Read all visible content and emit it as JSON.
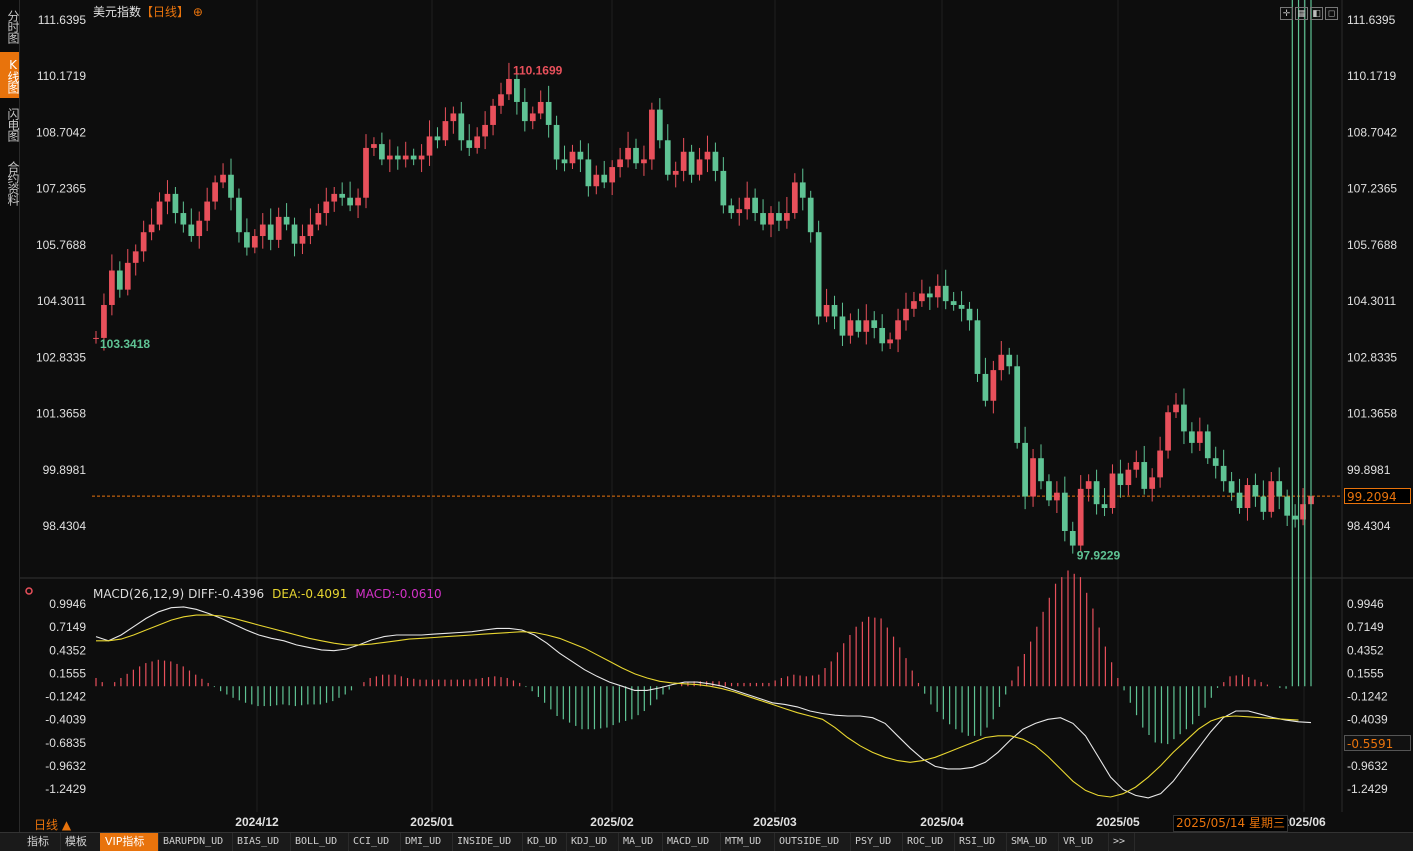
{
  "window": {
    "title": "美元指数",
    "period_tag": "【日线】",
    "add_icon": "circle-plus-icon"
  },
  "left_tabs": [
    {
      "label": "分时图",
      "active": false
    },
    {
      "label": "K线图",
      "active": true
    },
    {
      "label": "闪电图",
      "active": false
    },
    {
      "label": "合约资料",
      "active": false
    }
  ],
  "toolbar_icons": [
    "crosshair-icon",
    "grid-icon",
    "restore-icon",
    "maximize-icon"
  ],
  "colors": {
    "up": "#e8505b",
    "down": "#5fc394",
    "dif": "#e8e8e8",
    "dea": "#e8d630",
    "macd_label": "#d432c8",
    "accent": "#e8730c"
  },
  "price_axis": {
    "labels": [
      "111.6395",
      "110.1719",
      "108.7042",
      "107.2365",
      "105.7688",
      "104.3011",
      "102.8335",
      "101.3658",
      "99.8981",
      "98.4304"
    ],
    "min": 97.5,
    "max": 111.6395
  },
  "macd_axis": {
    "labels": [
      "0.9946",
      "0.7149",
      "0.4352",
      "0.1555",
      "-0.1242",
      "-0.4039",
      "-0.6835",
      "-0.9632",
      "-1.2429"
    ],
    "top": 0.9946,
    "bottom": -1.2429
  },
  "time_axis": [
    "2024/12",
    "2025/01",
    "2025/02",
    "2025/03",
    "2025/04",
    "2025/05",
    "2025/06"
  ],
  "annotations": {
    "start_low": "103.3418",
    "high": "110.1699",
    "low": "97.9229"
  },
  "last_price": "99.2094",
  "macd_cursor_value": "-0.5591",
  "macd_legend": {
    "params": "MACD(26,12,9)",
    "diff": "DIFF:-0.4396",
    "dea": "DEA:-0.4091",
    "macd": "MACD:-0.0610"
  },
  "period_label": "日线 ▲",
  "date_tip": "2025/05/14 星期三",
  "bottom_tabs": [
    "指标",
    "模板",
    "VIP指标",
    "BARUPDN_UD",
    "BIAS_UD",
    "BOLL_UD",
    "CCI_UD",
    "DMI_UD",
    "INSIDE_UD",
    "KD_UD",
    "KDJ_UD",
    "MA_UD",
    "MACD_UD",
    "MTM_UD",
    "OUTSIDE_UD",
    "PSY_UD",
    "ROC_UD",
    "RSI_UD",
    "SMA_UD",
    "VR_UD",
    ">>"
  ],
  "bottom_active_tab": "VIP指标",
  "chart_data": {
    "type": "candlestick",
    "title": "美元指数",
    "period": "日线",
    "x": [
      "2024/12",
      "2025/01",
      "2025/02",
      "2025/03",
      "2025/04",
      "2025/05",
      "2025/06"
    ],
    "ylim": [
      97.5,
      111.6395
    ],
    "closes": [
      103.34,
      104.2,
      105.1,
      104.6,
      105.3,
      105.6,
      106.1,
      106.3,
      106.9,
      107.1,
      106.6,
      106.3,
      106.0,
      106.4,
      106.9,
      107.4,
      107.6,
      107.0,
      106.1,
      105.7,
      106.0,
      106.3,
      105.9,
      106.5,
      106.3,
      105.8,
      106.0,
      106.3,
      106.6,
      106.9,
      107.1,
      107.0,
      106.8,
      107.0,
      108.3,
      108.4,
      108.0,
      108.1,
      108.0,
      108.1,
      108.0,
      108.1,
      108.6,
      108.5,
      109.0,
      109.2,
      108.5,
      108.3,
      108.6,
      108.9,
      109.4,
      109.7,
      110.1,
      109.5,
      109.0,
      109.2,
      109.5,
      108.9,
      108.0,
      107.9,
      108.2,
      108.0,
      107.3,
      107.6,
      107.4,
      107.8,
      108.0,
      108.3,
      107.9,
      108.0,
      109.3,
      108.5,
      107.6,
      107.7,
      108.2,
      107.6,
      108.0,
      108.2,
      107.7,
      106.8,
      106.6,
      106.7,
      107.0,
      106.6,
      106.3,
      106.6,
      106.4,
      106.6,
      107.4,
      107.0,
      106.1,
      103.9,
      104.2,
      103.9,
      103.4,
      103.8,
      103.5,
      103.8,
      103.6,
      103.2,
      103.3,
      103.8,
      104.1,
      104.3,
      104.5,
      104.4,
      104.7,
      104.3,
      104.2,
      104.1,
      103.8,
      102.4,
      101.7,
      102.5,
      102.9,
      102.6,
      100.6,
      99.2,
      100.2,
      99.6,
      99.1,
      99.3,
      98.3,
      97.92,
      99.4,
      99.6,
      99.0,
      98.9,
      99.8,
      99.5,
      99.9,
      100.1,
      99.4,
      99.7,
      100.4,
      101.4,
      101.6,
      100.9,
      100.6,
      100.9,
      100.2,
      100.0,
      99.6,
      99.3,
      98.9,
      99.5,
      99.2,
      98.8,
      99.6,
      99.2,
      98.7,
      98.6,
      99.0,
      99.2094
    ],
    "high_value": 110.1699,
    "low_value": 97.9229,
    "start_low_value": 103.3418,
    "last_value": 99.2094,
    "macd": {
      "params": [
        26,
        12,
        9
      ],
      "ylim": [
        -1.2429,
        0.9946
      ],
      "dif": [
        0.6,
        0.55,
        0.62,
        0.72,
        0.82,
        0.9,
        0.95,
        0.96,
        0.93,
        0.88,
        0.82,
        0.75,
        0.68,
        0.62,
        0.58,
        0.55,
        0.5,
        0.47,
        0.44,
        0.43,
        0.45,
        0.5,
        0.56,
        0.6,
        0.62,
        0.62,
        0.62,
        0.63,
        0.64,
        0.65,
        0.66,
        0.68,
        0.7,
        0.7,
        0.68,
        0.62,
        0.52,
        0.4,
        0.3,
        0.2,
        0.12,
        0.05,
        0.0,
        -0.05,
        -0.05,
        -0.02,
        0.02,
        0.05,
        0.05,
        0.03,
        0.0,
        -0.05,
        -0.1,
        -0.15,
        -0.2,
        -0.22,
        -0.25,
        -0.3,
        -0.33,
        -0.35,
        -0.36,
        -0.36,
        -0.38,
        -0.45,
        -0.6,
        -0.75,
        -0.88,
        -0.97,
        -1.0,
        -1.0,
        -0.98,
        -0.92,
        -0.8,
        -0.65,
        -0.52,
        -0.45,
        -0.4,
        -0.38,
        -0.45,
        -0.6,
        -0.85,
        -1.1,
        -1.25,
        -1.32,
        -1.35,
        -1.3,
        -1.15,
        -0.95,
        -0.75,
        -0.55,
        -0.38,
        -0.3,
        -0.3,
        -0.34,
        -0.38,
        -0.41,
        -0.43,
        -0.44
      ],
      "dea": [
        0.55,
        0.55,
        0.57,
        0.62,
        0.68,
        0.74,
        0.8,
        0.84,
        0.86,
        0.86,
        0.85,
        0.82,
        0.78,
        0.74,
        0.7,
        0.66,
        0.62,
        0.58,
        0.55,
        0.52,
        0.5,
        0.5,
        0.51,
        0.53,
        0.55,
        0.57,
        0.58,
        0.59,
        0.6,
        0.61,
        0.62,
        0.63,
        0.64,
        0.65,
        0.66,
        0.65,
        0.62,
        0.58,
        0.52,
        0.46,
        0.38,
        0.3,
        0.22,
        0.15,
        0.1,
        0.06,
        0.04,
        0.03,
        0.02,
        0.0,
        -0.03,
        -0.07,
        -0.12,
        -0.17,
        -0.22,
        -0.27,
        -0.32,
        -0.36,
        -0.4,
        -0.5,
        -0.62,
        -0.72,
        -0.8,
        -0.86,
        -0.9,
        -0.92,
        -0.9,
        -0.86,
        -0.8,
        -0.74,
        -0.68,
        -0.62,
        -0.6,
        -0.6,
        -0.64,
        -0.72,
        -0.85,
        -1.0,
        -1.15,
        -1.26,
        -1.32,
        -1.34,
        -1.3,
        -1.22,
        -1.1,
        -0.96,
        -0.8,
        -0.66,
        -0.52,
        -0.42,
        -0.37,
        -0.36,
        -0.37,
        -0.38,
        -0.39,
        -0.4,
        -0.41
      ]
    }
  }
}
